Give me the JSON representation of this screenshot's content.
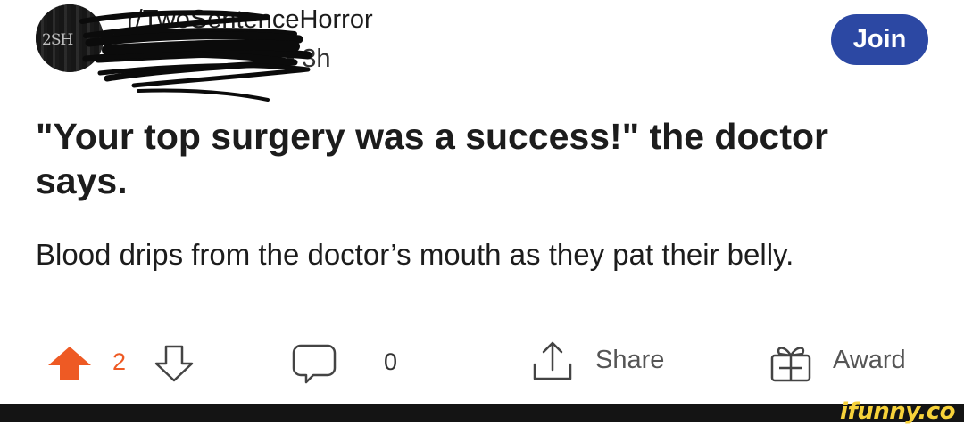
{
  "post": {
    "subreddit": "r/TwoSentenceHorror",
    "avatar_text": "2SH",
    "meta_separator": "•",
    "age": "3h",
    "join_label": "Join",
    "title": "\"Your top surgery was a success!\" the doctor says.",
    "body": "Blood drips from the doctor’s mouth as they pat their belly."
  },
  "actions": {
    "upvote_count": "2",
    "comment_count": "0",
    "share_label": "Share",
    "award_label": "Award"
  },
  "footer": {
    "watermark": "ifunny.co"
  },
  "colors": {
    "upvote_active": "#ee5a24",
    "join_bg": "#2c48a3",
    "footer_bg": "#141414",
    "watermark": "#f7d23a"
  }
}
